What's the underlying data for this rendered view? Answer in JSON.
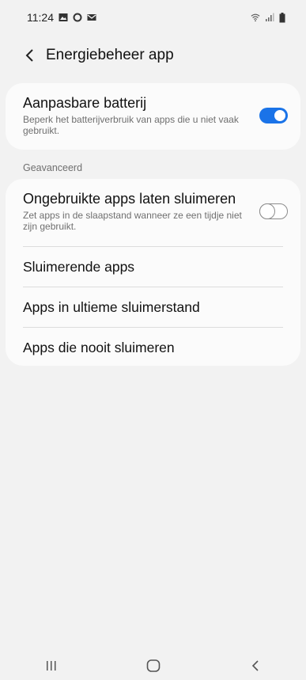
{
  "status_bar": {
    "time": "11:24",
    "left_icons": [
      "gallery-icon",
      "circle-icon",
      "mail-icon"
    ],
    "right_icons": [
      "wifi-icon",
      "signal-icon",
      "battery-icon"
    ]
  },
  "header": {
    "title": "Energiebeheer app"
  },
  "adaptive_battery": {
    "title": "Aanpasbare batterij",
    "subtitle": "Beperk het batterijverbruik van apps die u niet vaak gebruikt.",
    "enabled": true
  },
  "advanced": {
    "section_label": "Geavanceerd",
    "sleep_unused": {
      "title": "Ongebruikte apps laten sluimeren",
      "subtitle": "Zet apps in de slaapstand wanneer ze een tijdje niet zijn gebruikt.",
      "enabled": false
    },
    "items": [
      {
        "label": "Sluimerende apps"
      },
      {
        "label": "Apps in ultieme sluimerstand"
      },
      {
        "label": "Apps die nooit sluimeren"
      }
    ]
  },
  "colors": {
    "accent": "#1a73e8",
    "background": "#f2f2f2",
    "card": "#fbfbfb"
  },
  "navigation": {
    "icons": [
      "recents-icon",
      "home-icon",
      "back-icon"
    ]
  }
}
